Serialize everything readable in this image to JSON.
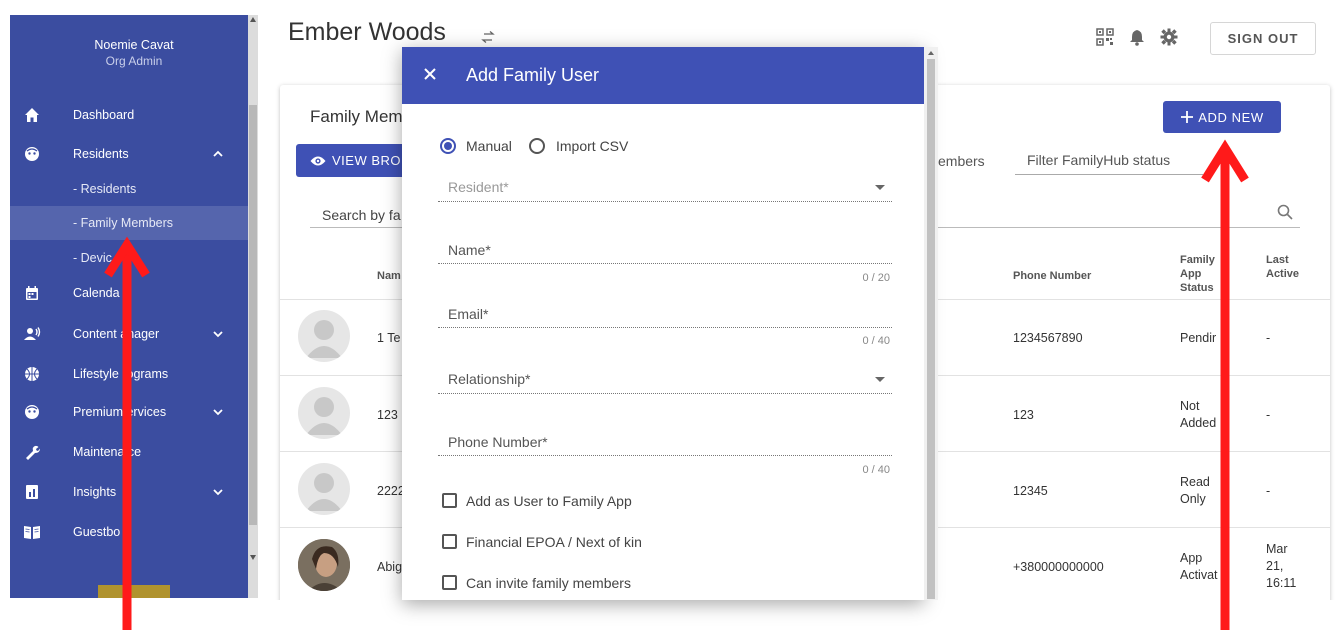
{
  "sidebar": {
    "user_name": "Noemie Cavat",
    "user_role": "Org Admin",
    "items": [
      {
        "label": "Dashboard",
        "icon": "home-icon"
      },
      {
        "label": "Residents",
        "icon": "resident-face-icon"
      },
      {
        "label": "- Residents"
      },
      {
        "label": "- Family Members"
      },
      {
        "label": "- Devic"
      },
      {
        "label": "Calenda",
        "icon": "calendar-icon"
      },
      {
        "label": "Content  anager",
        "icon": "content-manager-icon"
      },
      {
        "label": "Lifestyle  rograms",
        "icon": "basketball-icon"
      },
      {
        "label": "Premium  ervices",
        "icon": "premium-face-icon"
      },
      {
        "label": "Maintena  ce",
        "icon": "wrench-icon"
      },
      {
        "label": "Insights",
        "icon": "insights-icon"
      },
      {
        "label": "Guestbo",
        "icon": "book-icon"
      }
    ]
  },
  "header": {
    "title": "Ember Woods",
    "sign_out": "SIGN OUT"
  },
  "card": {
    "title": "Family Mem",
    "view_button": "VIEW BRO",
    "add_button": "ADD NEW",
    "filter_members": "embers",
    "filter_status": "Filter FamilyHub status",
    "search_placeholder": "Search by fa",
    "columns": {
      "name": "Nam",
      "phone": "Phone Number",
      "family_status": "Family App Status",
      "last_active": "Last Active"
    },
    "rows": [
      {
        "name": "1 Te",
        "phone": "1234567890",
        "status": "Pendir",
        "last": "-"
      },
      {
        "name": "123",
        "phone": "123",
        "status": "Not Added",
        "last": "-"
      },
      {
        "name": "2222",
        "phone": "12345",
        "status": "Read Only",
        "last": "-"
      },
      {
        "name": "Abig",
        "phone": "+380000000000",
        "status": "App Activat",
        "last": "Mar 21, 16:11"
      }
    ]
  },
  "modal": {
    "title": "Add Family User",
    "radio_manual": "Manual",
    "radio_import": "Import CSV",
    "resident_label": "Resident*",
    "name_label": "Name*",
    "name_counter": "0 / 20",
    "email_label": "Email*",
    "email_counter": "0 / 40",
    "relationship_label": "Relationship*",
    "phone_label": "Phone Number*",
    "phone_counter": "0 / 40",
    "check_add_user": "Add as User to Family App",
    "check_financial": "Financial EPOA / Next of kin",
    "check_invite": "Can invite family members"
  },
  "colors": {
    "sidebar_bg": "#3b4da0",
    "primary": "#3f51b5",
    "annotation_arrow": "#ff1a1a"
  }
}
